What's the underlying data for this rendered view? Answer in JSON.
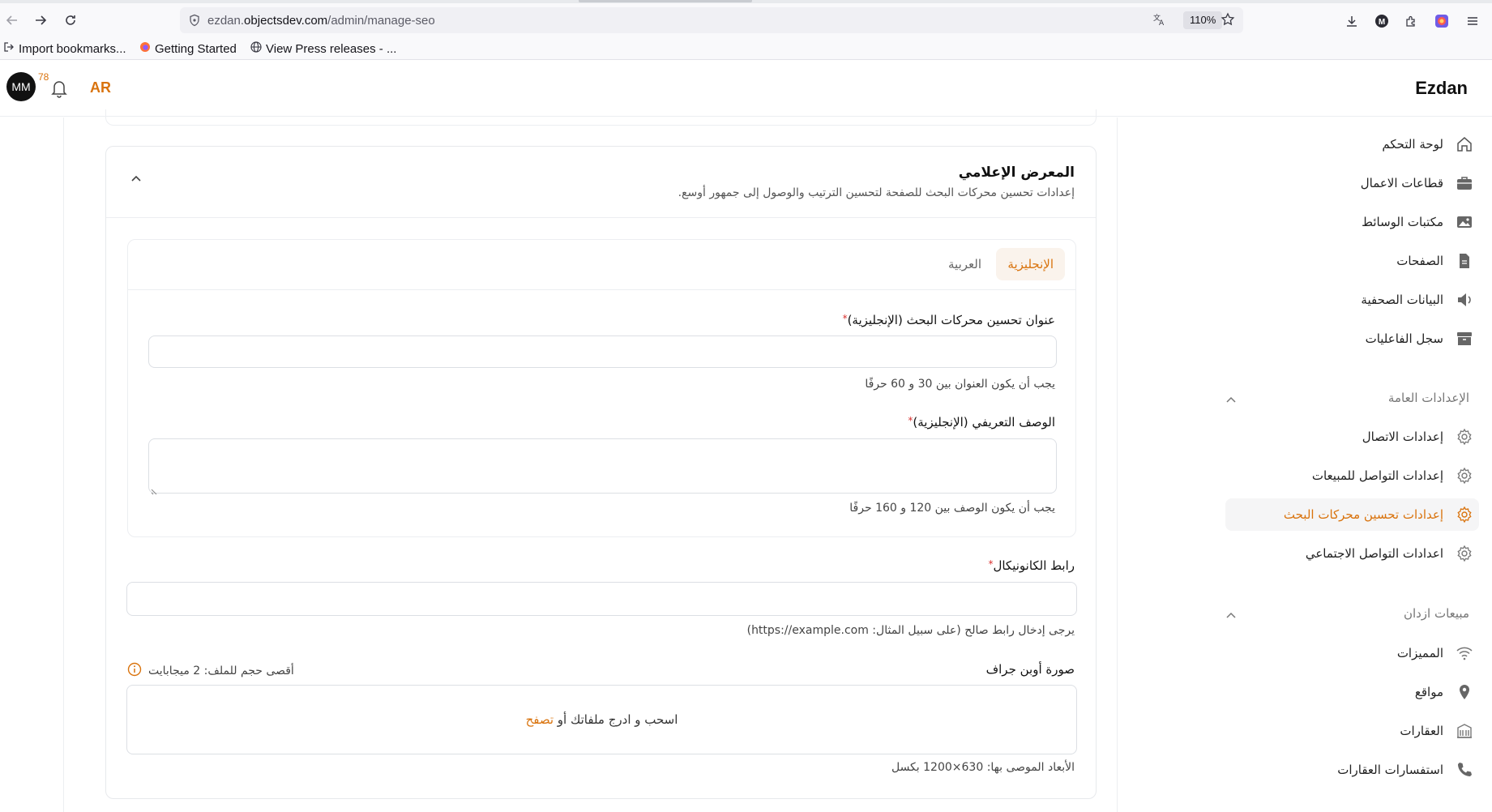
{
  "browser": {
    "url_prefix": "ezdan.",
    "url_host": "objectsdev.com",
    "url_path": "/admin/manage-seo",
    "zoom": "110%",
    "bookmarks": [
      {
        "label": "Import bookmarks...",
        "icon": "import-icon"
      },
      {
        "label": "Getting Started",
        "icon": "firefox-icon"
      },
      {
        "label": "View Press releases - ...",
        "icon": "globe-icon"
      }
    ]
  },
  "header": {
    "avatar_initials": "MM",
    "notification_count": "78",
    "language_toggle": "AR",
    "brand": "Ezdan"
  },
  "card": {
    "title": "المعرض الإعلامي",
    "subtitle": "إعدادات تحسين محركات البحث للصفحة لتحسين الترتيب والوصول إلى جمهور أوسع.",
    "tabs": {
      "english": "الإنجليزية",
      "arabic": "العربية"
    },
    "seo_title": {
      "label": "عنوان تحسين محركات البحث (الإنجليزية)",
      "required_mark": "*",
      "value": "",
      "hint": "يجب أن يكون العنوان بين 30 و 60 حرفًا"
    },
    "seo_description": {
      "label": "الوصف التعريفي (الإنجليزية)",
      "required_mark": "*",
      "value": "",
      "hint": "يجب أن يكون الوصف بين 120 و 160 حرفًا"
    },
    "canonical": {
      "label": "رابط الكانونيكال",
      "required_mark": "*",
      "value": "",
      "hint": "يرجى إدخال رابط صالح (على سبيل المثال: https://example.com)"
    },
    "og_image": {
      "label": "صورة أوبن جراف",
      "max_size": "أقصى حجم للملف: 2 ميجابايت",
      "drop_text": "اسحب و ادرج ملفاتك أو",
      "browse": "تصفح",
      "dimensions": "الأبعاد الموصى بها: 630×1200 بكسل"
    }
  },
  "sidebar": {
    "items": [
      {
        "label": "لوحة التحكم",
        "icon": "home-icon"
      },
      {
        "label": "قطاعات الاعمال",
        "icon": "briefcase-icon"
      },
      {
        "label": "مكتبات الوسائط",
        "icon": "image-icon"
      },
      {
        "label": "الصفحات",
        "icon": "document-icon"
      },
      {
        "label": "البيانات الصحفية",
        "icon": "speaker-icon"
      },
      {
        "label": "سجل الفاعليات",
        "icon": "archive-icon"
      }
    ],
    "general_settings": {
      "heading": "الإعدادات العامة",
      "items": [
        {
          "label": "إعدادات الاتصال",
          "icon": "gear-icon"
        },
        {
          "label": "إعدادات التواصل للمبيعات",
          "icon": "gear-icon"
        },
        {
          "label": "إعدادات تحسين محركات البحث",
          "icon": "gear-icon",
          "active": true
        },
        {
          "label": "اعدادات التواصل الاجتماعي",
          "icon": "gear-icon"
        }
      ]
    },
    "ezdan_sales": {
      "heading": "مبيعات ازدان",
      "items": [
        {
          "label": "المميزات",
          "icon": "wifi-icon"
        },
        {
          "label": "مواقع",
          "icon": "location-pin-icon"
        },
        {
          "label": "العقارات",
          "icon": "building-icon"
        },
        {
          "label": "استفسارات العقارات",
          "icon": "phone-icon"
        }
      ]
    }
  },
  "colors": {
    "accent": "#d9730d",
    "required": "#d9302f",
    "border": "#dcdfe4"
  }
}
